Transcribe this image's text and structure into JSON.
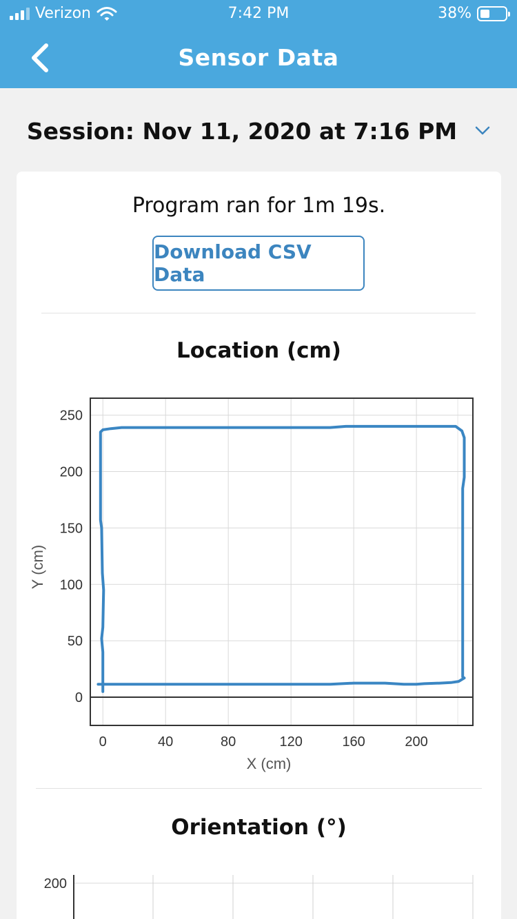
{
  "status_bar": {
    "carrier": "Verizon",
    "time": "7:42 PM",
    "battery_text": "38%",
    "battery_level": 0.38,
    "signal_bars_active": 3
  },
  "nav": {
    "title": "Sensor Data",
    "back_icon": "chevron-left-icon"
  },
  "session": {
    "label": "Session: Nov 11, 2020 at 7:16 PM",
    "dropdown_icon": "chevron-down-icon"
  },
  "summary": {
    "program_text": "Program ran for 1m 19s.",
    "download_label": "Download CSV Data"
  },
  "colors": {
    "header": "#4aa8de",
    "accent": "#3c85bf",
    "line": "#3a86c3"
  },
  "chart_data": [
    {
      "type": "line",
      "title": "Location (cm)",
      "xlabel": "X (cm)",
      "ylabel": "Y (cm)",
      "xlim": [
        -8,
        236
      ],
      "ylim": [
        -25,
        265
      ],
      "x_ticks": [
        0,
        40,
        80,
        120,
        160,
        200
      ],
      "y_ticks": [
        0,
        50,
        100,
        150,
        200,
        250
      ],
      "grid": true,
      "series": [
        {
          "points": [
            [
              0,
              5
            ],
            [
              0,
              40
            ],
            [
              -0.8,
              52
            ],
            [
              0,
              62
            ],
            [
              0.5,
              95
            ],
            [
              -0.3,
              110
            ],
            [
              -0.8,
              150
            ],
            [
              -1.5,
              157
            ],
            [
              -1.5,
              235
            ],
            [
              0,
              237
            ],
            [
              5,
              238
            ],
            [
              12,
              239
            ],
            [
              80,
              239
            ],
            [
              145,
              239
            ],
            [
              155,
              240
            ],
            [
              200,
              240
            ],
            [
              225,
              240
            ],
            [
              229,
              236
            ],
            [
              230.5,
              230
            ],
            [
              230.5,
              195
            ],
            [
              229.5,
              185
            ],
            [
              229.5,
              18
            ],
            [
              230.5,
              17
            ],
            [
              227,
              14
            ],
            [
              222,
              13
            ],
            [
              215,
              12.5
            ],
            [
              205,
              12
            ],
            [
              200,
              11.5
            ],
            [
              192,
              11.5
            ],
            [
              180,
              12.5
            ],
            [
              160,
              12.5
            ],
            [
              145,
              11.5
            ],
            [
              100,
              11.5
            ],
            [
              50,
              11.5
            ],
            [
              10,
              11.5
            ],
            [
              -3,
              11.5
            ]
          ]
        }
      ]
    },
    {
      "type": "line",
      "title": "Orientation (°)",
      "y_ticks": [
        200
      ],
      "grid": true,
      "series": []
    }
  ]
}
